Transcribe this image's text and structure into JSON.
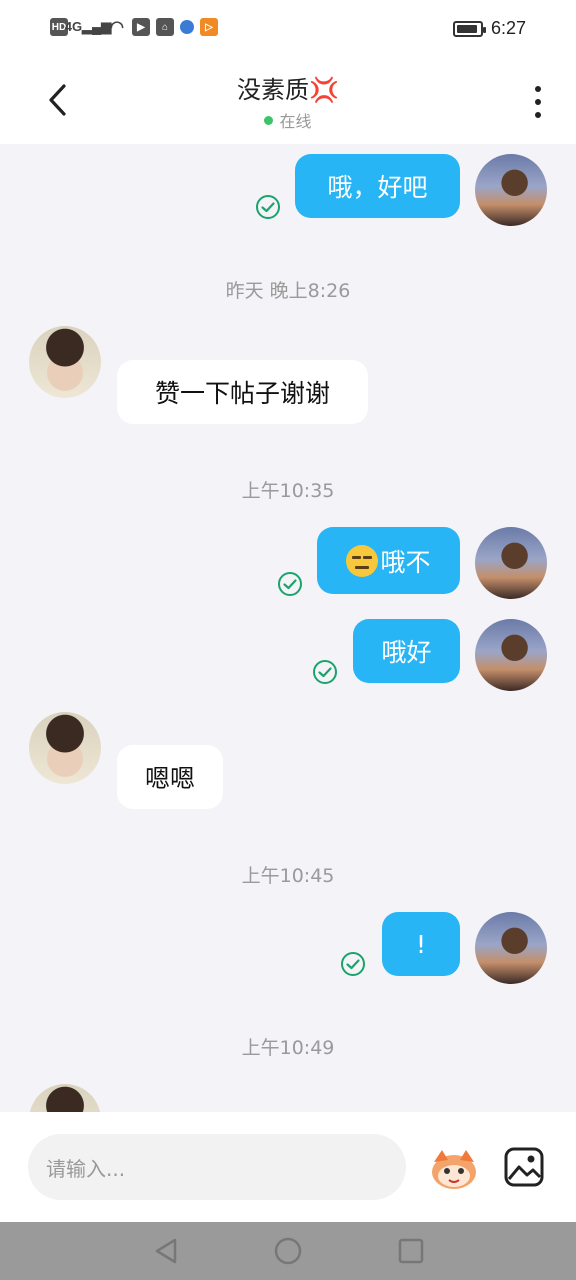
{
  "status_bar": {
    "left_icons": [
      "HD",
      "4G",
      "signal-icon",
      "wifi-icon",
      "video-icon",
      "bag-icon",
      "browser-icon",
      "play-icon"
    ],
    "battery_level": 0.9,
    "time": "6:27"
  },
  "header": {
    "title": "没素质💢",
    "status": "在线",
    "online_color": "#3cc46a"
  },
  "messages": [
    {
      "side": "me",
      "text": "哦，好吧",
      "delivered": true
    },
    {
      "type": "time",
      "text": "昨天 晚上8:26"
    },
    {
      "side": "other",
      "text": "赞一下帖子谢谢"
    },
    {
      "type": "time",
      "text": "上午10:35"
    },
    {
      "side": "me",
      "text": "哦不",
      "emoji": "expressionless-face-icon",
      "delivered": true
    },
    {
      "side": "me",
      "text": "哦好",
      "delivered": true
    },
    {
      "side": "other",
      "text": "嗯嗯"
    },
    {
      "type": "time",
      "text": "上午10:45"
    },
    {
      "side": "me",
      "text": "!",
      "delivered": true
    },
    {
      "type": "time",
      "text": "上午10:49"
    }
  ],
  "input": {
    "placeholder": "请输入..."
  },
  "colors": {
    "my_bubble": "#28b5f5",
    "background": "#f3f3f8",
    "check": "#1aa36b"
  }
}
